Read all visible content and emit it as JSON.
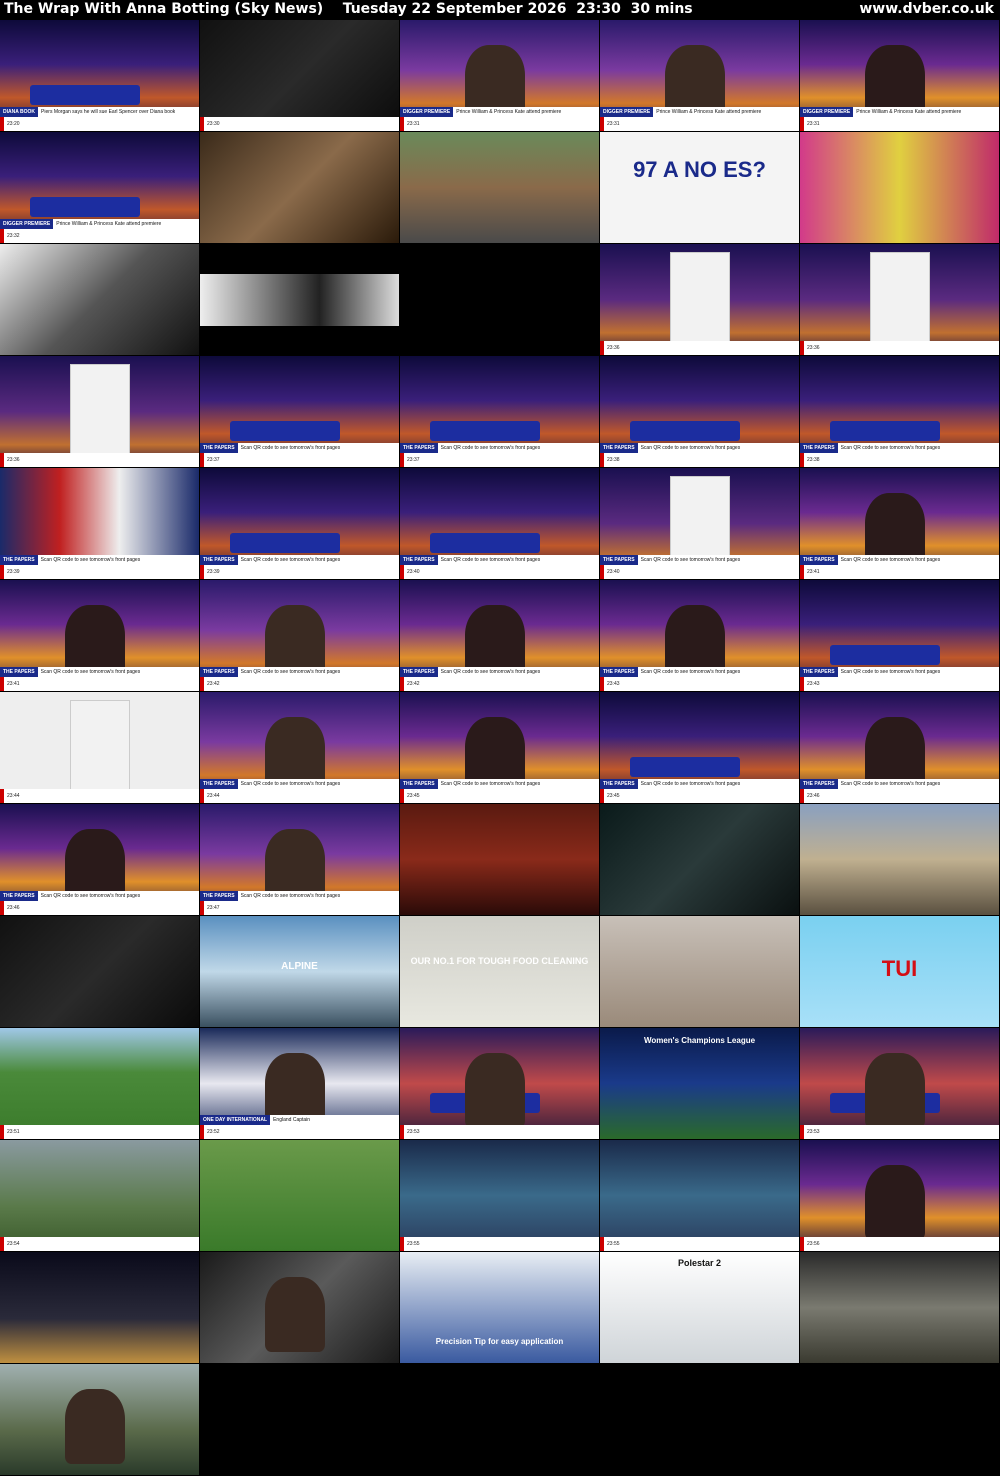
{
  "header": {
    "title": "The Wrap With Anna Botting (Sky News)    Tuesday 22 September 2026  23:30  30 mins",
    "site": "www.dvber.co.uk"
  },
  "thumbs": [
    {
      "kind": "studio",
      "strap": "DIANA BOOK",
      "strap_text": "Piers Morgan says he will sue Earl Spencer over Diana book",
      "cap": "23:20"
    },
    {
      "kind": "dark",
      "strap": "",
      "strap_text": "",
      "cap": "23:30"
    },
    {
      "kind": "presenter",
      "strap": "DIGGER PREMIERE",
      "strap_text": "Prince William & Princess Kate attend premiere",
      "cap": "23:31"
    },
    {
      "kind": "presenter",
      "strap": "DIGGER PREMIERE",
      "strap_text": "Prince William & Princess Kate attend premiere",
      "cap": "23:31"
    },
    {
      "kind": "presenter-f",
      "strap": "DIGGER PREMIERE",
      "strap_text": "Prince William & Princess Kate attend premiere",
      "cap": "23:31"
    },
    {
      "kind": "studio",
      "strap": "DIGGER PREMIERE",
      "strap_text": "Prince William & Princess Kate attend premiere",
      "cap": "23:32"
    },
    {
      "kind": "warm",
      "strap": "",
      "strap_text": "",
      "cap": ""
    },
    {
      "kind": "street",
      "strap": "",
      "strap_text": "",
      "cap": ""
    },
    {
      "kind": "ad-97",
      "strap": "",
      "strap_text": "",
      "cap": "",
      "big": "97 A NO ES?"
    },
    {
      "kind": "blur",
      "strap": "",
      "strap_text": "",
      "cap": ""
    },
    {
      "kind": "car",
      "strap": "",
      "strap_text": "",
      "cap": ""
    },
    {
      "kind": "letterbox",
      "strap": "",
      "strap_text": "",
      "cap": ""
    },
    {
      "kind": "black",
      "strap": "",
      "strap_text": "",
      "cap": ""
    },
    {
      "kind": "papers",
      "strap": "",
      "strap_text": "",
      "cap": "23:36"
    },
    {
      "kind": "papers",
      "strap": "",
      "strap_text": "",
      "cap": "23:36"
    },
    {
      "kind": "papers",
      "strap": "",
      "strap_text": "",
      "cap": "23:36"
    },
    {
      "kind": "studio",
      "strap": "THE PAPERS",
      "strap_text": "Scan QR code to see tomorrow's front pages",
      "cap": "23:37"
    },
    {
      "kind": "studio",
      "strap": "THE PAPERS",
      "strap_text": "Scan QR code to see tomorrow's front pages",
      "cap": "23:37"
    },
    {
      "kind": "studio",
      "strap": "THE PAPERS",
      "strap_text": "Scan QR code to see tomorrow's front pages",
      "cap": "23:38"
    },
    {
      "kind": "studio",
      "strap": "THE PAPERS",
      "strap_text": "Scan QR code to see tomorrow's front pages",
      "cap": "23:38"
    },
    {
      "kind": "flags",
      "strap": "THE PAPERS",
      "strap_text": "Scan QR code to see tomorrow's front pages",
      "cap": "23:39"
    },
    {
      "kind": "studio",
      "strap": "THE PAPERS",
      "strap_text": "Scan QR code to see tomorrow's front pages",
      "cap": "23:39"
    },
    {
      "kind": "studio",
      "strap": "THE PAPERS",
      "strap_text": "Scan QR code to see tomorrow's front pages",
      "cap": "23:40"
    },
    {
      "kind": "papers",
      "strap": "THE PAPERS",
      "strap_text": "Scan QR code to see tomorrow's front pages",
      "cap": "23:40"
    },
    {
      "kind": "presenter-f",
      "strap": "THE PAPERS",
      "strap_text": "Scan QR code to see tomorrow's front pages",
      "cap": "23:41"
    },
    {
      "kind": "presenter-f",
      "strap": "THE PAPERS",
      "strap_text": "Scan QR code to see tomorrow's front pages",
      "cap": "23:41"
    },
    {
      "kind": "presenter",
      "strap": "THE PAPERS",
      "strap_text": "Scan QR code to see tomorrow's front pages",
      "cap": "23:42"
    },
    {
      "kind": "presenter-f",
      "strap": "THE PAPERS",
      "strap_text": "Scan QR code to see tomorrow's front pages",
      "cap": "23:42"
    },
    {
      "kind": "presenter-f",
      "strap": "THE PAPERS",
      "strap_text": "Scan QR code to see tomorrow's front pages",
      "cap": "23:43"
    },
    {
      "kind": "studio",
      "strap": "THE PAPERS",
      "strap_text": "Scan QR code to see tomorrow's front pages",
      "cap": "23:43"
    },
    {
      "kind": "newspaper",
      "strap": "",
      "strap_text": "",
      "cap": "23:44"
    },
    {
      "kind": "presenter",
      "strap": "THE PAPERS",
      "strap_text": "Scan QR code to see tomorrow's front pages",
      "cap": "23:44"
    },
    {
      "kind": "presenter-f",
      "strap": "THE PAPERS",
      "strap_text": "Scan QR code to see tomorrow's front pages",
      "cap": "23:45"
    },
    {
      "kind": "studio",
      "strap": "THE PAPERS",
      "strap_text": "Scan QR code to see tomorrow's front pages",
      "cap": "23:45"
    },
    {
      "kind": "presenter-f",
      "strap": "THE PAPERS",
      "strap_text": "Scan QR code to see tomorrow's front pages",
      "cap": "23:46"
    },
    {
      "kind": "presenter-f",
      "strap": "THE PAPERS",
      "strap_text": "Scan QR code to see tomorrow's front pages",
      "cap": "23:46"
    },
    {
      "kind": "presenter",
      "strap": "THE PAPERS",
      "strap_text": "Scan QR code to see tomorrow's front pages",
      "cap": "23:47"
    },
    {
      "kind": "brick",
      "strap": "",
      "strap_text": "",
      "cap": ""
    },
    {
      "kind": "night",
      "strap": "",
      "strap_text": "",
      "cap": ""
    },
    {
      "kind": "town",
      "strap": "",
      "strap_text": "",
      "cap": ""
    },
    {
      "kind": "dark",
      "strap": "",
      "strap_text": "",
      "cap": ""
    },
    {
      "kind": "alpine",
      "strap": "",
      "strap_text": "",
      "cap": "",
      "big": "ALPINE"
    },
    {
      "kind": "fairy",
      "strap": "",
      "strap_text": "",
      "cap": "",
      "big": "OUR NO.1 FOR TOUGH FOOD CLEANING"
    },
    {
      "kind": "room",
      "strap": "",
      "strap_text": "",
      "cap": ""
    },
    {
      "kind": "tui",
      "strap": "",
      "strap_text": "",
      "cap": "",
      "big": "TUI"
    },
    {
      "kind": "cricket",
      "strap": "",
      "strap_text": "",
      "cap": "23:51"
    },
    {
      "kind": "press",
      "strap": "ONE DAY INTERNATIONAL",
      "strap_text": "England Captain",
      "cap": "23:52"
    },
    {
      "kind": "anchor",
      "strap": "",
      "strap_text": "",
      "cap": "23:53"
    },
    {
      "kind": "score",
      "strap": "",
      "strap_text": "",
      "cap": "",
      "big": "Women's Champions League"
    },
    {
      "kind": "anchor",
      "strap": "",
      "strap_text": "",
      "cap": "23:53"
    },
    {
      "kind": "field",
      "strap": "",
      "strap_text": "",
      "cap": "23:54"
    },
    {
      "kind": "dog",
      "strap": "",
      "strap_text": "",
      "cap": ""
    },
    {
      "kind": "weather",
      "strap": "",
      "strap_text": "",
      "cap": "23:55"
    },
    {
      "kind": "weather",
      "strap": "",
      "strap_text": "",
      "cap": "23:55"
    },
    {
      "kind": "presenter-f",
      "strap": "",
      "strap_text": "",
      "cap": "23:56"
    },
    {
      "kind": "castle",
      "strap": "",
      "strap_text": "",
      "cap": ""
    },
    {
      "kind": "kitchen",
      "strap": "",
      "strap_text": "",
      "cap": ""
    },
    {
      "kind": "fixodent",
      "strap": "",
      "strap_text": "",
      "cap": "",
      "big": "Precision Tip for easy application"
    },
    {
      "kind": "polestar",
      "strap": "",
      "strap_text": "",
      "cap": "",
      "big": "Polestar 2"
    },
    {
      "kind": "street2",
      "strap": "",
      "strap_text": "",
      "cap": ""
    },
    {
      "kind": "portrait",
      "strap": "",
      "strap_text": "",
      "cap": ""
    }
  ]
}
